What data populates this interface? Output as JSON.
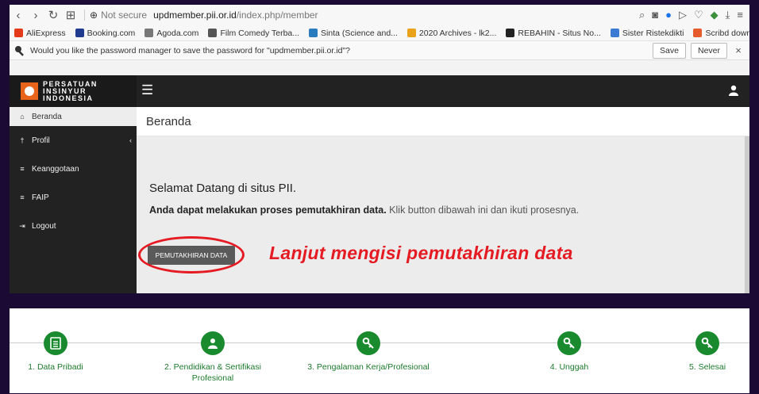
{
  "browser": {
    "security": "Not secure",
    "url_domain": "updmember.pii.or.id",
    "url_path": "/index.php/member",
    "bookmarks": [
      {
        "label": "AliExpress",
        "color": "#e43a1a"
      },
      {
        "label": "Booking.com",
        "color": "#1f3c8f"
      },
      {
        "label": "Agoda.com",
        "color": "#777777"
      },
      {
        "label": "Film Comedy Terba...",
        "color": "#555555"
      },
      {
        "label": "Sinta (Science and...",
        "color": "#2a7cbf"
      },
      {
        "label": "2020 Archives - lk2...",
        "color": "#e9a21a"
      },
      {
        "label": "REBAHIN - Situs No...",
        "color": "#222222"
      },
      {
        "label": "Sister Ristekdikti",
        "color": "#3b7bd4"
      },
      {
        "label": "Scribd download",
        "color": "#e55b2b"
      }
    ],
    "password_prompt": "Would you like the password manager to save the password for \"updmember.pii.or.id\"?",
    "save_label": "Save",
    "never_label": "Never"
  },
  "app": {
    "logo_lines": [
      "PERSATUAN",
      "INSINYUR",
      "INDONESIA"
    ],
    "sidebar": [
      {
        "label": "Beranda",
        "icon": "home-icon",
        "glyph": "⌂",
        "active": true
      },
      {
        "label": "Profil",
        "icon": "profile-icon",
        "glyph": "†",
        "active": false
      },
      {
        "label": "Keanggotaan",
        "icon": "list-icon",
        "glyph": "≡",
        "active": false
      },
      {
        "label": "FAIP",
        "icon": "list-icon",
        "glyph": "≡",
        "active": false
      },
      {
        "label": "Logout",
        "icon": "logout-icon",
        "glyph": "⇥",
        "active": false
      }
    ],
    "page_title": "Beranda",
    "welcome": "Selamat Datang di situs PII.",
    "desc_bold": "Anda dapat melakukan proses pemutakhiran data.",
    "desc_rest": " Klik button dibawah ini dan ikuti prosesnya.",
    "button_label": "PEMUTAKHIRAN DATA",
    "callout": "Lanjut mengisi pemutakhiran data",
    "accent_red": "#e51b24"
  },
  "steps": [
    {
      "label": "1. Data Pribadi",
      "icon": "document-icon"
    },
    {
      "label": "2. Pendidikan & Sertifikasi Profesional",
      "icon": "user-icon"
    },
    {
      "label": "3. Pengalaman Kerja/Profesional",
      "icon": "key-icon"
    },
    {
      "label": "4. Unggah",
      "icon": "key-icon"
    },
    {
      "label": "5. Selesai",
      "icon": "key-icon"
    }
  ],
  "step_color": "#1a8a2e"
}
